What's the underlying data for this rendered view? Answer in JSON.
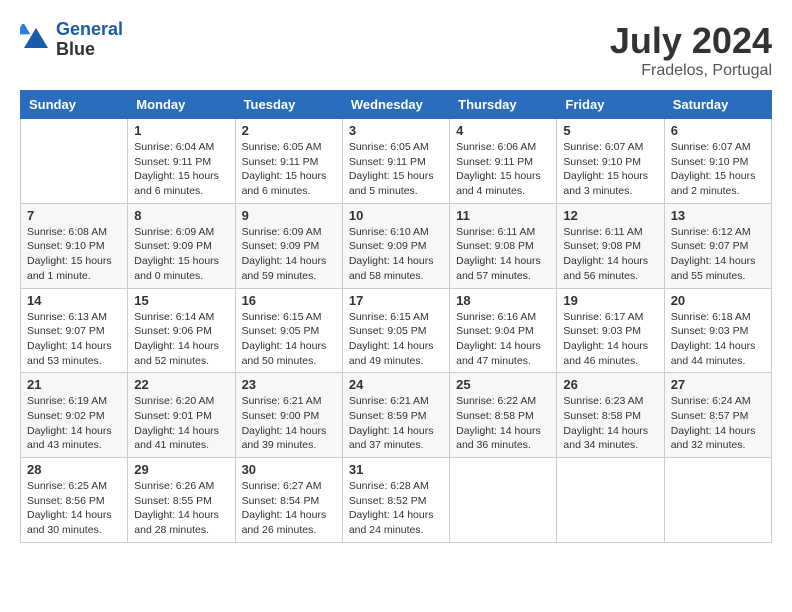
{
  "header": {
    "logo_line1": "General",
    "logo_line2": "Blue",
    "month_year": "July 2024",
    "location": "Fradelos, Portugal"
  },
  "weekdays": [
    "Sunday",
    "Monday",
    "Tuesday",
    "Wednesday",
    "Thursday",
    "Friday",
    "Saturday"
  ],
  "weeks": [
    [
      {
        "day": "",
        "sunrise": "",
        "sunset": "",
        "daylight": ""
      },
      {
        "day": "1",
        "sunrise": "Sunrise: 6:04 AM",
        "sunset": "Sunset: 9:11 PM",
        "daylight": "Daylight: 15 hours and 6 minutes."
      },
      {
        "day": "2",
        "sunrise": "Sunrise: 6:05 AM",
        "sunset": "Sunset: 9:11 PM",
        "daylight": "Daylight: 15 hours and 6 minutes."
      },
      {
        "day": "3",
        "sunrise": "Sunrise: 6:05 AM",
        "sunset": "Sunset: 9:11 PM",
        "daylight": "Daylight: 15 hours and 5 minutes."
      },
      {
        "day": "4",
        "sunrise": "Sunrise: 6:06 AM",
        "sunset": "Sunset: 9:11 PM",
        "daylight": "Daylight: 15 hours and 4 minutes."
      },
      {
        "day": "5",
        "sunrise": "Sunrise: 6:07 AM",
        "sunset": "Sunset: 9:10 PM",
        "daylight": "Daylight: 15 hours and 3 minutes."
      },
      {
        "day": "6",
        "sunrise": "Sunrise: 6:07 AM",
        "sunset": "Sunset: 9:10 PM",
        "daylight": "Daylight: 15 hours and 2 minutes."
      }
    ],
    [
      {
        "day": "7",
        "sunrise": "Sunrise: 6:08 AM",
        "sunset": "Sunset: 9:10 PM",
        "daylight": "Daylight: 15 hours and 1 minute."
      },
      {
        "day": "8",
        "sunrise": "Sunrise: 6:09 AM",
        "sunset": "Sunset: 9:09 PM",
        "daylight": "Daylight: 15 hours and 0 minutes."
      },
      {
        "day": "9",
        "sunrise": "Sunrise: 6:09 AM",
        "sunset": "Sunset: 9:09 PM",
        "daylight": "Daylight: 14 hours and 59 minutes."
      },
      {
        "day": "10",
        "sunrise": "Sunrise: 6:10 AM",
        "sunset": "Sunset: 9:09 PM",
        "daylight": "Daylight: 14 hours and 58 minutes."
      },
      {
        "day": "11",
        "sunrise": "Sunrise: 6:11 AM",
        "sunset": "Sunset: 9:08 PM",
        "daylight": "Daylight: 14 hours and 57 minutes."
      },
      {
        "day": "12",
        "sunrise": "Sunrise: 6:11 AM",
        "sunset": "Sunset: 9:08 PM",
        "daylight": "Daylight: 14 hours and 56 minutes."
      },
      {
        "day": "13",
        "sunrise": "Sunrise: 6:12 AM",
        "sunset": "Sunset: 9:07 PM",
        "daylight": "Daylight: 14 hours and 55 minutes."
      }
    ],
    [
      {
        "day": "14",
        "sunrise": "Sunrise: 6:13 AM",
        "sunset": "Sunset: 9:07 PM",
        "daylight": "Daylight: 14 hours and 53 minutes."
      },
      {
        "day": "15",
        "sunrise": "Sunrise: 6:14 AM",
        "sunset": "Sunset: 9:06 PM",
        "daylight": "Daylight: 14 hours and 52 minutes."
      },
      {
        "day": "16",
        "sunrise": "Sunrise: 6:15 AM",
        "sunset": "Sunset: 9:05 PM",
        "daylight": "Daylight: 14 hours and 50 minutes."
      },
      {
        "day": "17",
        "sunrise": "Sunrise: 6:15 AM",
        "sunset": "Sunset: 9:05 PM",
        "daylight": "Daylight: 14 hours and 49 minutes."
      },
      {
        "day": "18",
        "sunrise": "Sunrise: 6:16 AM",
        "sunset": "Sunset: 9:04 PM",
        "daylight": "Daylight: 14 hours and 47 minutes."
      },
      {
        "day": "19",
        "sunrise": "Sunrise: 6:17 AM",
        "sunset": "Sunset: 9:03 PM",
        "daylight": "Daylight: 14 hours and 46 minutes."
      },
      {
        "day": "20",
        "sunrise": "Sunrise: 6:18 AM",
        "sunset": "Sunset: 9:03 PM",
        "daylight": "Daylight: 14 hours and 44 minutes."
      }
    ],
    [
      {
        "day": "21",
        "sunrise": "Sunrise: 6:19 AM",
        "sunset": "Sunset: 9:02 PM",
        "daylight": "Daylight: 14 hours and 43 minutes."
      },
      {
        "day": "22",
        "sunrise": "Sunrise: 6:20 AM",
        "sunset": "Sunset: 9:01 PM",
        "daylight": "Daylight: 14 hours and 41 minutes."
      },
      {
        "day": "23",
        "sunrise": "Sunrise: 6:21 AM",
        "sunset": "Sunset: 9:00 PM",
        "daylight": "Daylight: 14 hours and 39 minutes."
      },
      {
        "day": "24",
        "sunrise": "Sunrise: 6:21 AM",
        "sunset": "Sunset: 8:59 PM",
        "daylight": "Daylight: 14 hours and 37 minutes."
      },
      {
        "day": "25",
        "sunrise": "Sunrise: 6:22 AM",
        "sunset": "Sunset: 8:58 PM",
        "daylight": "Daylight: 14 hours and 36 minutes."
      },
      {
        "day": "26",
        "sunrise": "Sunrise: 6:23 AM",
        "sunset": "Sunset: 8:58 PM",
        "daylight": "Daylight: 14 hours and 34 minutes."
      },
      {
        "day": "27",
        "sunrise": "Sunrise: 6:24 AM",
        "sunset": "Sunset: 8:57 PM",
        "daylight": "Daylight: 14 hours and 32 minutes."
      }
    ],
    [
      {
        "day": "28",
        "sunrise": "Sunrise: 6:25 AM",
        "sunset": "Sunset: 8:56 PM",
        "daylight": "Daylight: 14 hours and 30 minutes."
      },
      {
        "day": "29",
        "sunrise": "Sunrise: 6:26 AM",
        "sunset": "Sunset: 8:55 PM",
        "daylight": "Daylight: 14 hours and 28 minutes."
      },
      {
        "day": "30",
        "sunrise": "Sunrise: 6:27 AM",
        "sunset": "Sunset: 8:54 PM",
        "daylight": "Daylight: 14 hours and 26 minutes."
      },
      {
        "day": "31",
        "sunrise": "Sunrise: 6:28 AM",
        "sunset": "Sunset: 8:52 PM",
        "daylight": "Daylight: 14 hours and 24 minutes."
      },
      {
        "day": "",
        "sunrise": "",
        "sunset": "",
        "daylight": ""
      },
      {
        "day": "",
        "sunrise": "",
        "sunset": "",
        "daylight": ""
      },
      {
        "day": "",
        "sunrise": "",
        "sunset": "",
        "daylight": ""
      }
    ]
  ]
}
